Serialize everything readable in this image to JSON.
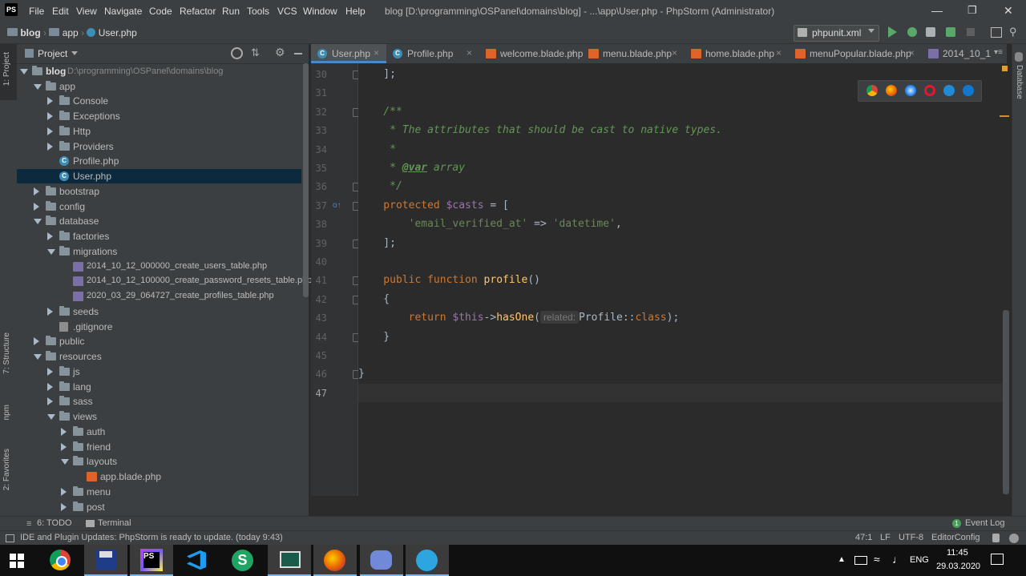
{
  "window": {
    "app_logo": "PS",
    "title": "blog [D:\\programming\\OSPanel\\domains\\blog] - ...\\app\\User.php - PhpStorm (Administrator)",
    "menu": [
      "File",
      "Edit",
      "View",
      "Navigate",
      "Code",
      "Refactor",
      "Run",
      "Tools",
      "VCS",
      "Window",
      "Help"
    ]
  },
  "breadcrumb": [
    "blog",
    "app",
    "User.php"
  ],
  "run_config": "phpunit.xml",
  "left_stripe": [
    "1: Project",
    "7: Structure",
    "npm",
    "2: Favorites"
  ],
  "right_stripe": [
    "Database"
  ],
  "project": {
    "header": "Project",
    "root_label": "blog",
    "root_path": "D:\\programming\\OSPanel\\domains\\blog",
    "items": [
      {
        "label": "app",
        "type": "folder",
        "open": true,
        "depth": 1
      },
      {
        "label": "Console",
        "type": "folder",
        "open": false,
        "depth": 2
      },
      {
        "label": "Exceptions",
        "type": "folder",
        "open": false,
        "depth": 2
      },
      {
        "label": "Http",
        "type": "folder",
        "open": false,
        "depth": 2
      },
      {
        "label": "Providers",
        "type": "folder",
        "open": false,
        "depth": 2
      },
      {
        "label": "Profile.php",
        "type": "php",
        "depth": 2
      },
      {
        "label": "User.php",
        "type": "php",
        "depth": 2,
        "selected": true
      },
      {
        "label": "bootstrap",
        "type": "folder",
        "open": false,
        "depth": 1
      },
      {
        "label": "config",
        "type": "folder",
        "open": false,
        "depth": 1
      },
      {
        "label": "database",
        "type": "folder",
        "open": true,
        "depth": 1
      },
      {
        "label": "factories",
        "type": "folder",
        "open": false,
        "depth": 2
      },
      {
        "label": "migrations",
        "type": "folder",
        "open": true,
        "depth": 2
      },
      {
        "label": "2014_10_12_000000_create_users_table.php",
        "type": "migration",
        "depth": 3
      },
      {
        "label": "2014_10_12_100000_create_password_resets_table.php",
        "type": "migration",
        "depth": 3
      },
      {
        "label": "2020_03_29_064727_create_profiles_table.php",
        "type": "migration",
        "depth": 3
      },
      {
        "label": "seeds",
        "type": "folder",
        "open": false,
        "depth": 2
      },
      {
        "label": ".gitignore",
        "type": "git",
        "depth": 2
      },
      {
        "label": "public",
        "type": "folder",
        "open": false,
        "depth": 1
      },
      {
        "label": "resources",
        "type": "folder",
        "open": true,
        "depth": 1
      },
      {
        "label": "js",
        "type": "folder",
        "open": false,
        "depth": 2
      },
      {
        "label": "lang",
        "type": "folder",
        "open": false,
        "depth": 2
      },
      {
        "label": "sass",
        "type": "folder",
        "open": false,
        "depth": 2
      },
      {
        "label": "views",
        "type": "folder",
        "open": true,
        "depth": 2
      },
      {
        "label": "auth",
        "type": "folder",
        "open": false,
        "depth": 3
      },
      {
        "label": "friend",
        "type": "folder",
        "open": false,
        "depth": 3
      },
      {
        "label": "layouts",
        "type": "folder",
        "open": true,
        "depth": 3
      },
      {
        "label": "app.blade.php",
        "type": "blade",
        "depth": 4
      },
      {
        "label": "menu",
        "type": "folder",
        "open": false,
        "depth": 3
      },
      {
        "label": "post",
        "type": "folder",
        "open": false,
        "depth": 3
      }
    ]
  },
  "tabs": [
    {
      "label": "User.php",
      "icon": "php",
      "active": true
    },
    {
      "label": "Profile.php",
      "icon": "php"
    },
    {
      "label": "welcome.blade.php",
      "icon": "blade"
    },
    {
      "label": "menu.blade.php",
      "icon": "blade"
    },
    {
      "label": "home.blade.php",
      "icon": "blade"
    },
    {
      "label": "menuPopular.blade.php",
      "icon": "blade"
    },
    {
      "label": "2014_10_1",
      "icon": "migration"
    }
  ],
  "code": {
    "first_line_number": 30,
    "current_line": 47,
    "lines": [
      [
        [
          "plain",
          "    ];"
        ]
      ],
      [],
      [
        [
          "doc",
          "    /**"
        ]
      ],
      [
        [
          "doc",
          "     * The attributes that should be cast to native types."
        ]
      ],
      [
        [
          "doc",
          "     *"
        ]
      ],
      [
        [
          "doc",
          "     * "
        ],
        [
          "doctag",
          "@var"
        ],
        [
          "doc",
          " array"
        ]
      ],
      [
        [
          "doc",
          "     */"
        ]
      ],
      [
        [
          "kw",
          "    protected "
        ],
        [
          "var",
          "$casts"
        ],
        [
          "plain",
          " = ["
        ]
      ],
      [
        [
          "str",
          "        'email_verified_at'"
        ],
        [
          "plain",
          " => "
        ],
        [
          "str",
          "'datetime'"
        ],
        [
          "plain",
          ","
        ]
      ],
      [
        [
          "plain",
          "    ];"
        ]
      ],
      [],
      [
        [
          "kw",
          "    public function "
        ],
        [
          "fn",
          "profile"
        ],
        [
          "plain",
          "()"
        ]
      ],
      [
        [
          "plain",
          "    {"
        ]
      ],
      [
        [
          "kw",
          "        return "
        ],
        [
          "var",
          "$this"
        ],
        [
          "plain",
          "->"
        ],
        [
          "fn",
          "hasOne"
        ],
        [
          "plain",
          "("
        ],
        [
          "hint",
          "related:"
        ],
        [
          "plain",
          "Profile::"
        ],
        [
          "kw",
          "class"
        ],
        [
          "plain",
          ");"
        ]
      ],
      [
        [
          "plain",
          "    }"
        ]
      ],
      [],
      [
        [
          "plain",
          "}"
        ]
      ],
      []
    ]
  },
  "tool_windows": {
    "todo": "6: TODO",
    "terminal": "Terminal",
    "event_log": "Event Log"
  },
  "status": {
    "message": "IDE and Plugin Updates: PhpStorm is ready to update. (today 9:43)",
    "position": "47:1",
    "line_sep": "LF",
    "encoding": "UTF-8",
    "config": "EditorConfig"
  },
  "taskbar": {
    "apps": [
      "windows-start",
      "chrome",
      "save-app",
      "phpstorm",
      "vscode",
      "s-app",
      "monitor-app",
      "firefox",
      "discord",
      "telegram"
    ],
    "lang": "ENG",
    "time": "11:45",
    "date": "29.03.2020"
  },
  "colors": {
    "accent": "#4a88c7",
    "selection": "#0d293e",
    "editor_bg": "#2b2b2b",
    "panel_bg": "#3c3f41"
  }
}
